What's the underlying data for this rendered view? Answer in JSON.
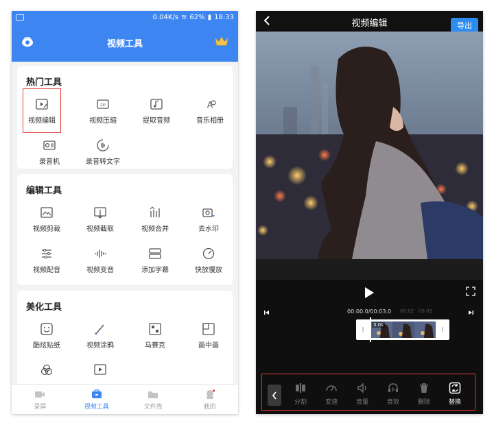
{
  "left": {
    "status_bar": {
      "speed": "0.04K/s",
      "battery": "62%",
      "time": "18:33"
    },
    "header": {
      "title": "视频工具"
    },
    "sections": [
      {
        "title": "热门工具",
        "tools": [
          {
            "label": "视频编辑",
            "icon": "video-edit-icon"
          },
          {
            "label": "视频压缩",
            "icon": "video-compress-icon"
          },
          {
            "label": "提取音频",
            "icon": "extract-audio-icon"
          },
          {
            "label": "音乐相册",
            "icon": "music-album-icon"
          },
          {
            "label": "录音机",
            "icon": "recorder-icon"
          },
          {
            "label": "录音转文字",
            "icon": "speech-to-text-icon"
          }
        ]
      },
      {
        "title": "编辑工具",
        "tools": [
          {
            "label": "视频剪裁",
            "icon": "video-crop-icon"
          },
          {
            "label": "视频截取",
            "icon": "video-trim-icon"
          },
          {
            "label": "视频合并",
            "icon": "video-merge-icon"
          },
          {
            "label": "去水印",
            "icon": "remove-watermark-icon"
          },
          {
            "label": "视频配音",
            "icon": "video-dub-icon"
          },
          {
            "label": "视频变音",
            "icon": "voice-change-icon"
          },
          {
            "label": "添加字幕",
            "icon": "subtitle-icon"
          },
          {
            "label": "快放慢放",
            "icon": "speed-icon"
          }
        ]
      },
      {
        "title": "美化工具",
        "tools": [
          {
            "label": "酷炫贴纸",
            "icon": "sticker-icon"
          },
          {
            "label": "视频涂鸦",
            "icon": "doodle-icon"
          },
          {
            "label": "马赛克",
            "icon": "mosaic-icon"
          },
          {
            "label": "画中画",
            "icon": "pip-icon"
          }
        ]
      }
    ],
    "bottom_nav": [
      {
        "label": "录屏",
        "icon": "screen-record-icon"
      },
      {
        "label": "视频工具",
        "icon": "toolbox-icon",
        "active": true
      },
      {
        "label": "文件库",
        "icon": "folder-icon"
      },
      {
        "label": "我的",
        "icon": "profile-icon"
      }
    ],
    "colors": {
      "brand": "#3d86f2",
      "highlight": "#e53935"
    }
  },
  "right": {
    "header": {
      "title": "视频编辑",
      "export_label": "导出"
    },
    "player": {
      "time_current": "00:00.0",
      "time_total": "00:03.0",
      "marks": [
        "00:02",
        "00:02"
      ],
      "clip_duration": "3.0s"
    },
    "toolbar": [
      {
        "label": "分割",
        "icon": "split-icon"
      },
      {
        "label": "变速",
        "icon": "speedometer-icon"
      },
      {
        "label": "音量",
        "icon": "volume-icon"
      },
      {
        "label": "音效",
        "icon": "sound-effect-icon"
      },
      {
        "label": "删除",
        "icon": "trash-icon"
      },
      {
        "label": "替换",
        "icon": "replace-icon",
        "bright": true
      }
    ],
    "colors": {
      "export": "#2d8cf0",
      "highlight": "#e53935"
    }
  }
}
